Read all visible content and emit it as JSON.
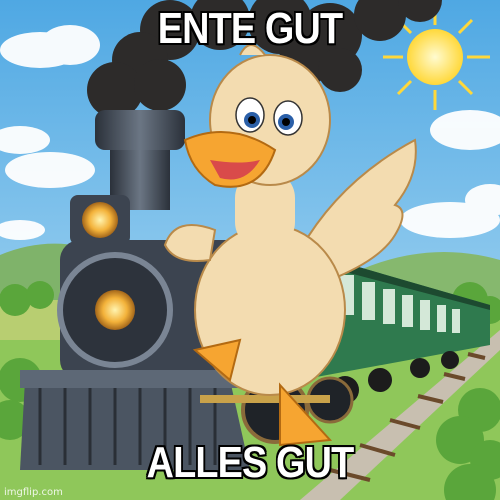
{
  "meme": {
    "top_text": "ENTE GUT",
    "bottom_text": "ALLES GUT",
    "watermark": "imgflip.com"
  },
  "scene": {
    "illustration": "cartoon-duck-riding-steam-locomotive",
    "colors": {
      "sky": "#7cc3ee",
      "smoke": "#2d2b2a",
      "duck": "#f3dcb0",
      "beak": "#f6a531",
      "train_body": "#2f7a4e",
      "locomotive": "#3c4450",
      "sun": "#ffe55a",
      "grass": "#6ab24a"
    }
  }
}
